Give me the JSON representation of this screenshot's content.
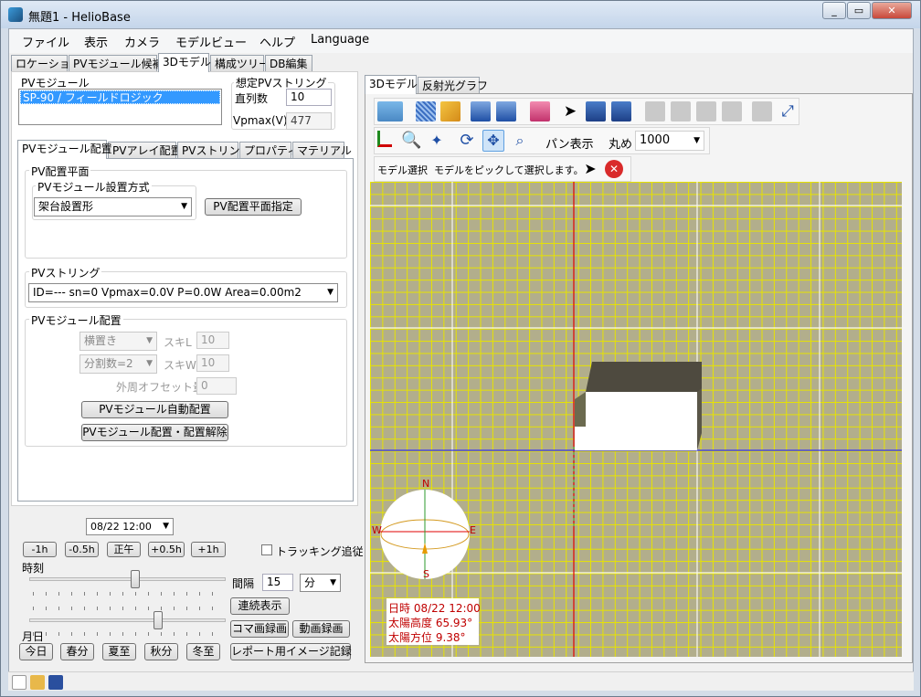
{
  "window": {
    "title": "無題1 - HelioBase",
    "minimize": "▭",
    "maximize": "▭",
    "close": "✕"
  },
  "menu": [
    "ファイル",
    "表示",
    "カメラ",
    "モデルビュー",
    "ヘルプ",
    "Language"
  ],
  "main_tabs": [
    "ロケーション",
    "PVモジュール候補",
    "3Dモデル",
    "構成ツリー",
    "DB編集"
  ],
  "pv_module": {
    "label": "PVモジュール",
    "selected": "SP-90 / フィールドロジック"
  },
  "assumed_string": {
    "label": "想定PVストリング",
    "series_label": "直列数",
    "series_value": "10",
    "vpmax_label": "Vpmax(V)",
    "vpmax_value": "477"
  },
  "sub_tabs": [
    "PVモジュール配置",
    "PVアレイ配置",
    "PVストリング",
    "プロパティ",
    "マテリアル"
  ],
  "placement_plane": {
    "label": "PV配置平面",
    "method_label": "PVモジュール設置方式",
    "method_value": "架台設置形",
    "plane_button": "PV配置平面指定"
  },
  "pv_string": {
    "label": "PVストリング",
    "value": "ID=--- sn=0 Vpmax=0.0V P=0.0W Area=0.00m2"
  },
  "module_layout": {
    "label": "PVモジュール配置",
    "orientation": "横置き",
    "skip_l_label": "スキL",
    "skip_l": "10",
    "divisions": "分割数=2",
    "skip_w_label": "スキW",
    "skip_w": "10",
    "offset_label": "外周オフセット量",
    "offset": "0",
    "auto_button": "PVモジュール自動配置",
    "clear_button": "PVモジュール配置・配置解除"
  },
  "time_controls": {
    "datetime": "08/22 12:00",
    "buttons": [
      "-1h",
      "-0.5h",
      "正午",
      "+0.5h",
      "+1h"
    ],
    "tracking": "トラッキング追従",
    "time_label": "時刻",
    "day_label": "月日",
    "interval_label": "間隔",
    "interval_value": "15",
    "interval_unit": "分",
    "continuous": "連続表示",
    "frame_record": "コマ画録画",
    "video_record": "動画録画",
    "report": "レポート用イメージ記録",
    "day_buttons": [
      "今日",
      "春分",
      "夏至",
      "秋分",
      "冬至"
    ],
    "time_slider_pos": 0.5,
    "day_slider_pos": 0.62
  },
  "view_tabs": [
    "3Dモデル",
    "反射光グラフ"
  ],
  "toolbar": {
    "pan_label": "パン表示",
    "round_label": "丸め",
    "round_value": "1000"
  },
  "selection_bar": {
    "mode": "モデル選択",
    "hint": "モデルをピックして選択します。"
  },
  "compass": {
    "n": "N",
    "s": "S",
    "e": "E",
    "w": "W"
  },
  "sun_info": {
    "datetime": "日時 08/22 12:00",
    "altitude": "太陽高度 65.93°",
    "azimuth": "太陽方位 9.38°"
  },
  "colors": {
    "grid": "#e7e300",
    "ground": "#b2ae8c",
    "x_axis": "#2b2bff",
    "y_axis": "#e00000",
    "building_roof": "#4e4a3f",
    "info_text": "#c00000"
  }
}
